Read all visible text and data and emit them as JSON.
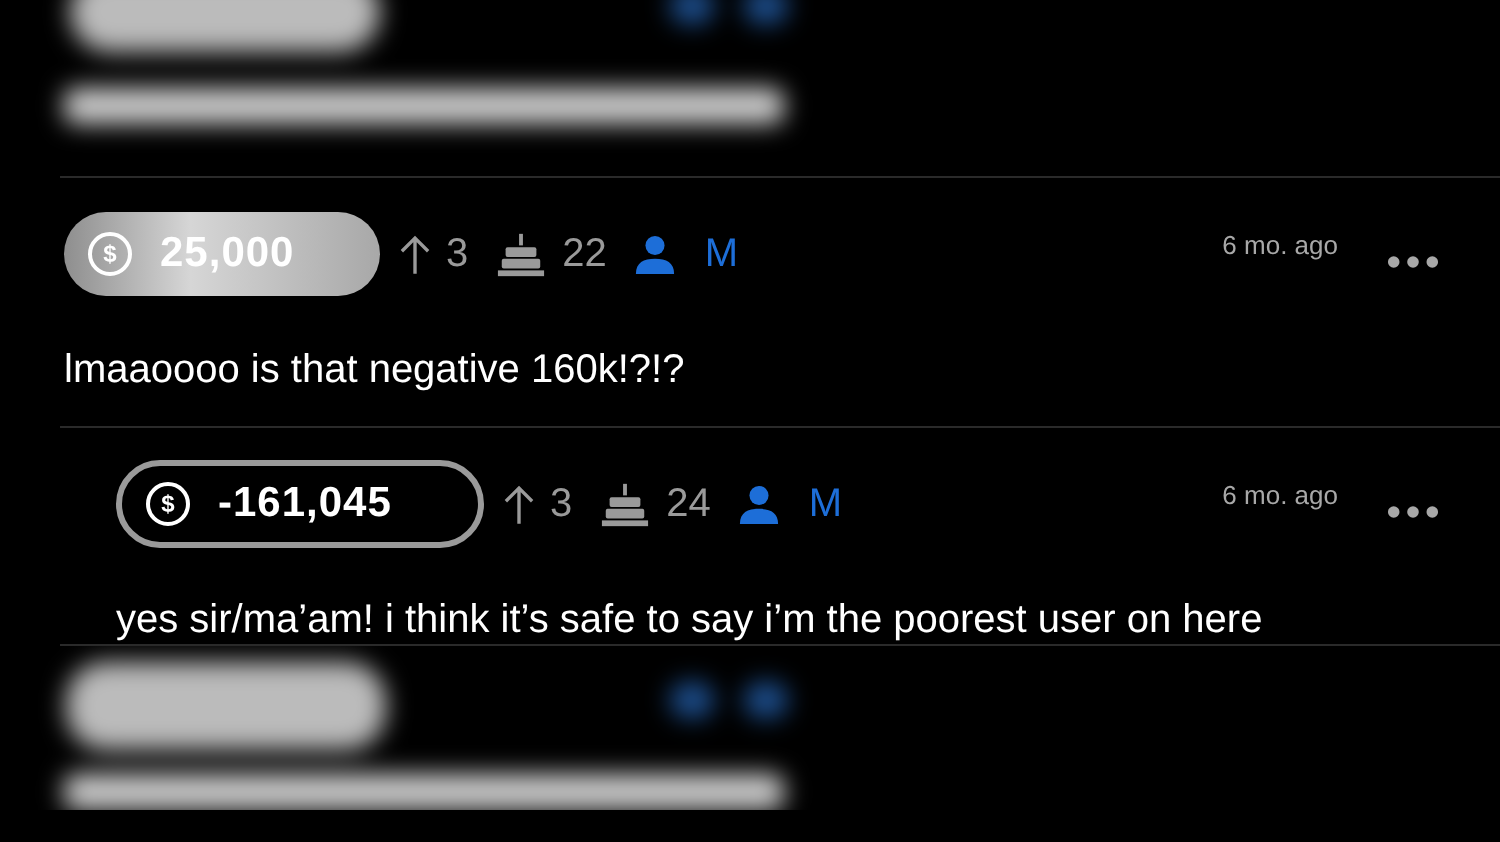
{
  "comments": [
    {
      "badge": {
        "kind": "filled",
        "symbol": "$",
        "amount": "25,000"
      },
      "upvotes": "3",
      "cake_days": "22",
      "author": "M",
      "time": "6 mo. ago",
      "text": "lmaaoooo is that negative 160k!?!?",
      "children": [
        {
          "badge": {
            "kind": "outlined",
            "symbol": "$",
            "amount": "-161,045"
          },
          "upvotes": "3",
          "cake_days": "24",
          "author": "M",
          "time": "6 mo. ago",
          "text": "yes sir/ma’am! i think it’s safe to say i’m the poorest user on here"
        }
      ]
    }
  ]
}
